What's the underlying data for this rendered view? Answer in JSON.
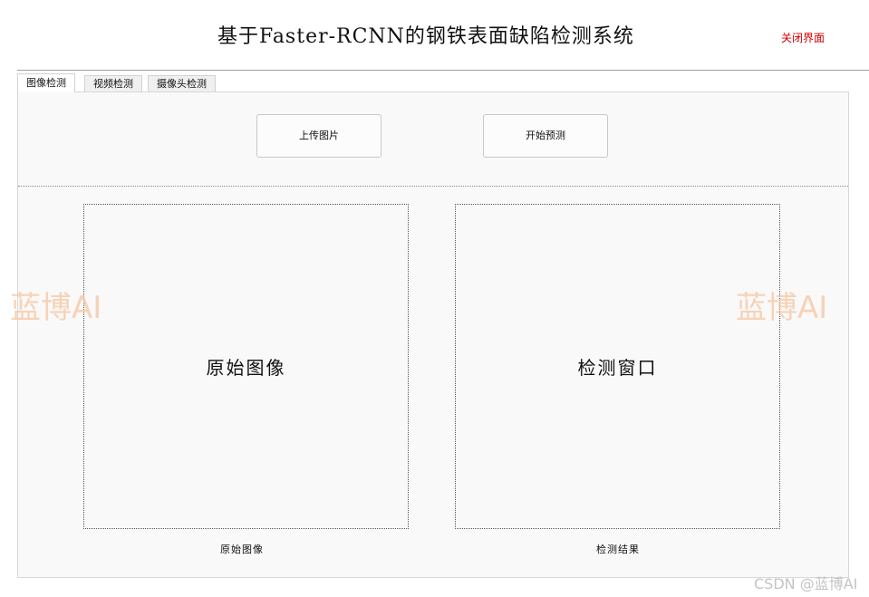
{
  "app": {
    "title": "基于Faster-RCNN的钢铁表面缺陷检测系统",
    "close_label": "关闭界面"
  },
  "tabs": [
    {
      "label": "图像检测",
      "active": true
    },
    {
      "label": "视频检测",
      "active": false
    },
    {
      "label": "摄像头检测",
      "active": false
    }
  ],
  "actions": {
    "upload_label": "上传图片",
    "predict_label": "开始预测"
  },
  "frames": {
    "original": {
      "text": "原始图像",
      "caption": "原始图像"
    },
    "result": {
      "text": "检测窗口",
      "caption": "检测结果"
    }
  },
  "watermarks": {
    "left": "蓝博AI",
    "right": "蓝博AI",
    "footer": "CSDN @蓝博AI"
  },
  "colors": {
    "close_link": "#d00000",
    "watermark": "#f7c9a6",
    "panel_bg": "#f9f9f9"
  }
}
